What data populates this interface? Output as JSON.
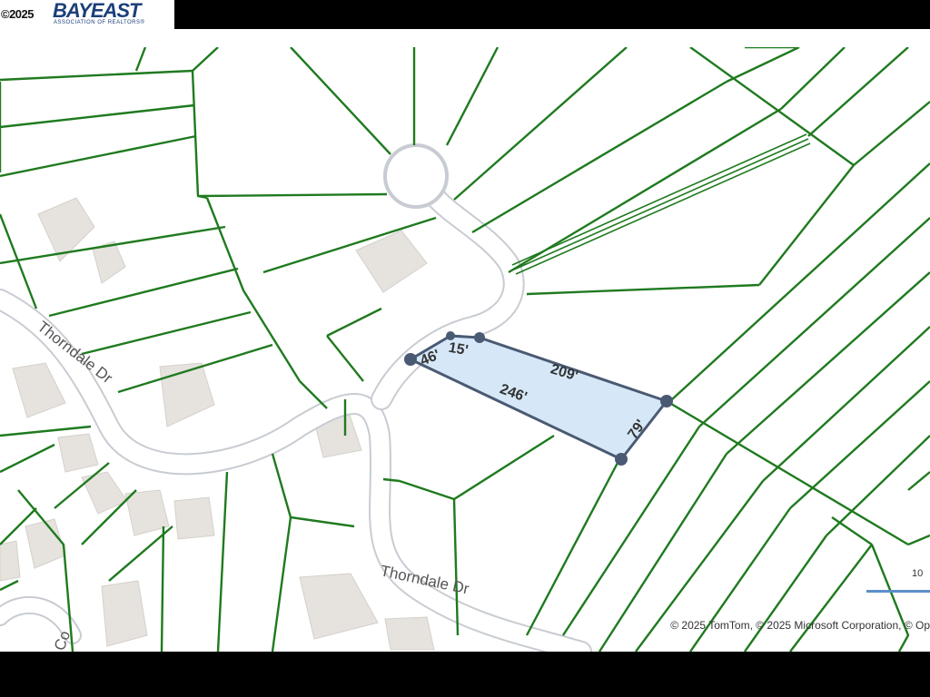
{
  "watermark": {
    "copyright": "©2025",
    "brand": "BAYEAST",
    "brand_sub": "ASSOCIATION OF REALTORS®"
  },
  "map": {
    "street_labels": [
      "Thorndale Dr",
      "Thorndale Dr",
      "Co"
    ],
    "parcel": {
      "fill_color": "#d6e8f8",
      "outline_color": "#4a5a73",
      "dimensions": [
        "46'",
        "15'",
        "209'",
        "246'",
        "79'"
      ]
    },
    "parcel_line_color": "#1f7a1f",
    "attribution": "© 2025 TomTom, © 2025 Microsoft Corporation, © Op",
    "scale_label": "10"
  }
}
